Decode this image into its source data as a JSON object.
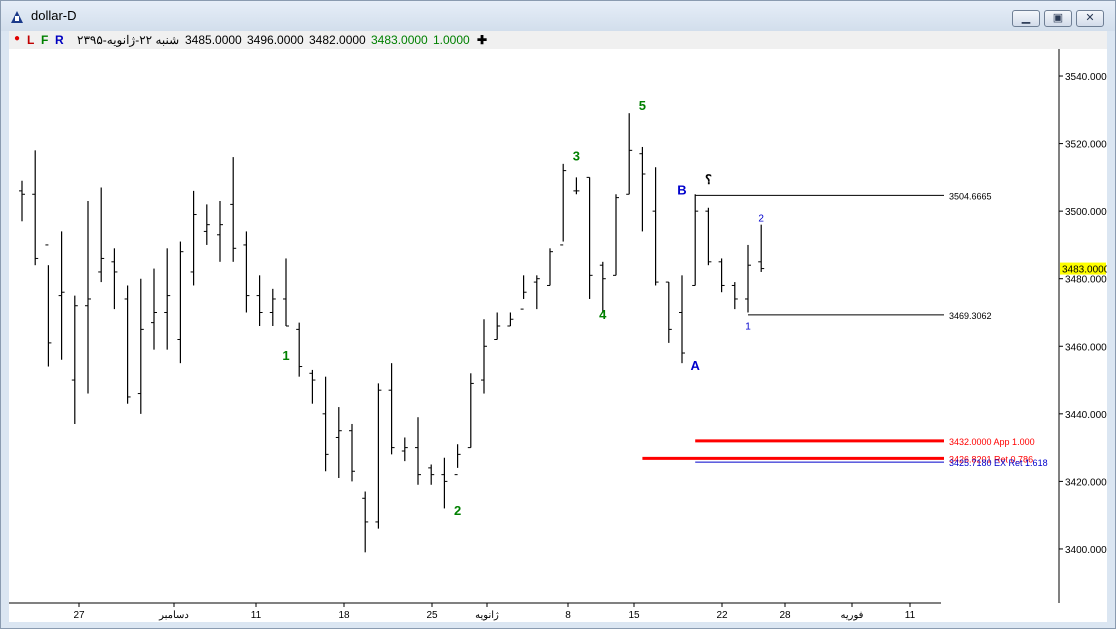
{
  "window": {
    "title": "dollar-D",
    "buttons": [
      "minimize",
      "maximize",
      "close"
    ]
  },
  "toolbar": {
    "dot": "●",
    "l_label": "L",
    "f_label": "F",
    "r_label": "R",
    "date": "شنبه ۲۲-ژانویه-۲۳۹۵",
    "open": "3485.0000",
    "high": "3496.0000",
    "low": "3482.0000",
    "close": "3483.0000",
    "volume": "1.0000",
    "crosshair": "✚"
  },
  "colors": {
    "bars": "#000000",
    "wave_labels": "#008000",
    "correction_labels": "#0000cc",
    "fib_red": "#ff0000",
    "fib_blue": "#0000cc",
    "price_tag": "#ffff00"
  },
  "chart_data": {
    "type": "ohlc",
    "ylim": [
      3384,
      3548
    ],
    "y_ticks": [
      3400,
      3420,
      3440,
      3460,
      3480,
      3500,
      3520,
      3540
    ],
    "y_tick_labels": [
      "3400.0000",
      "3420.0000",
      "3440.0000",
      "3460.0000",
      "3480.0000",
      "3500.0000",
      "3520.0000",
      "3540.0000"
    ],
    "x_tick_labels": [
      "27",
      "دسامبر",
      "11",
      "18",
      "25",
      "ژانویه",
      "8",
      "15",
      "22",
      "28",
      "فوریه",
      "11"
    ],
    "current_price": "3483.0000",
    "bars": [
      {
        "o": 3506,
        "h": 3509,
        "l": 3497,
        "c": 3505
      },
      {
        "o": 3505,
        "h": 3518,
        "l": 3484,
        "c": 3486
      },
      {
        "o": 3490,
        "h": 3484,
        "l": 3454,
        "c": 3461
      },
      {
        "o": 3475,
        "h": 3494,
        "l": 3456,
        "c": 3476
      },
      {
        "o": 3450,
        "h": 3475,
        "l": 3437,
        "c": 3472
      },
      {
        "o": 3472,
        "h": 3503,
        "l": 3446,
        "c": 3474
      },
      {
        "o": 3482,
        "h": 3507,
        "l": 3479,
        "c": 3486
      },
      {
        "o": 3485,
        "h": 3489,
        "l": 3471,
        "c": 3482
      },
      {
        "o": 3474,
        "h": 3478,
        "l": 3443,
        "c": 3445
      },
      {
        "o": 3446,
        "h": 3480,
        "l": 3440,
        "c": 3465
      },
      {
        "o": 3467,
        "h": 3483,
        "l": 3459,
        "c": 3470
      },
      {
        "o": 3470,
        "h": 3489,
        "l": 3459,
        "c": 3475
      },
      {
        "o": 3462,
        "h": 3491,
        "l": 3455,
        "c": 3488
      },
      {
        "o": 3482,
        "h": 3506,
        "l": 3478,
        "c": 3499
      },
      {
        "o": 3494,
        "h": 3502,
        "l": 3490,
        "c": 3496
      },
      {
        "o": 3493,
        "h": 3503,
        "l": 3485,
        "c": 3496
      },
      {
        "o": 3502,
        "h": 3516,
        "l": 3485,
        "c": 3489
      },
      {
        "o": 3490,
        "h": 3494,
        "l": 3470,
        "c": 3475
      },
      {
        "o": 3475,
        "h": 3481,
        "l": 3466,
        "c": 3470
      },
      {
        "o": 3470,
        "h": 3477,
        "l": 3466,
        "c": 3474
      },
      {
        "o": 3474,
        "h": 3486,
        "l": 3466,
        "c": 3466
      },
      {
        "o": 3465,
        "h": 3467,
        "l": 3451,
        "c": 3454
      },
      {
        "o": 3452,
        "h": 3453,
        "l": 3443,
        "c": 3450
      },
      {
        "o": 3440,
        "h": 3451,
        "l": 3423,
        "c": 3428
      },
      {
        "o": 3433,
        "h": 3442,
        "l": 3421,
        "c": 3435
      },
      {
        "o": 3435,
        "h": 3437,
        "l": 3420,
        "c": 3423
      },
      {
        "o": 3415,
        "h": 3417,
        "l": 3399,
        "c": 3408
      },
      {
        "o": 3408,
        "h": 3449,
        "l": 3406,
        "c": 3447
      },
      {
        "o": 3447,
        "h": 3455,
        "l": 3428,
        "c": 3430
      },
      {
        "o": 3429,
        "h": 3433,
        "l": 3426,
        "c": 3430
      },
      {
        "o": 3430,
        "h": 3439,
        "l": 3419,
        "c": 3422
      },
      {
        "o": 3424,
        "h": 3425,
        "l": 3419,
        "c": 3422
      },
      {
        "o": 3422,
        "h": 3427,
        "l": 3412,
        "c": 3420
      },
      {
        "o": 3422,
        "h": 3431,
        "l": 3424,
        "c": 3428
      },
      {
        "o": 3430,
        "h": 3452,
        "l": 3430,
        "c": 3449
      },
      {
        "o": 3450,
        "h": 3468,
        "l": 3446,
        "c": 3460
      },
      {
        "o": 3462,
        "h": 3470,
        "l": 3462,
        "c": 3466
      },
      {
        "o": 3466,
        "h": 3470,
        "l": 3466,
        "c": 3468
      },
      {
        "o": 3471,
        "h": 3481,
        "l": 3474,
        "c": 3476
      },
      {
        "o": 3479,
        "h": 3481,
        "l": 3471,
        "c": 3480
      },
      {
        "o": 3478,
        "h": 3489,
        "l": 3478,
        "c": 3488
      },
      {
        "o": 3490,
        "h": 3514,
        "l": 3491,
        "c": 3512
      },
      {
        "o": 3506,
        "h": 3510,
        "l": 3505,
        "c": 3506
      },
      {
        "o": 3510,
        "h": 3510,
        "l": 3474,
        "c": 3481
      },
      {
        "o": 3484,
        "h": 3485,
        "l": 3470,
        "c": 3480
      },
      {
        "o": 3481,
        "h": 3505,
        "l": 3481,
        "c": 3504
      },
      {
        "o": 3505,
        "h": 3529,
        "l": 3505,
        "c": 3518
      },
      {
        "o": 3517,
        "h": 3519,
        "l": 3494,
        "c": 3511
      },
      {
        "o": 3500,
        "h": 3513,
        "l": 3478,
        "c": 3479
      },
      {
        "o": 3479,
        "h": 3479,
        "l": 3461,
        "c": 3465
      },
      {
        "o": 3470,
        "h": 3481,
        "l": 3455,
        "c": 3458
      },
      {
        "o": 3478,
        "h": 3505,
        "l": 3478,
        "c": 3500
      },
      {
        "o": 3500,
        "h": 3501,
        "l": 3484,
        "c": 3485
      },
      {
        "o": 3485,
        "h": 3486,
        "l": 3476,
        "c": 3478
      },
      {
        "o": 3478,
        "h": 3479,
        "l": 3471,
        "c": 3474
      },
      {
        "o": 3474,
        "h": 3490,
        "l": 3470,
        "c": 3484
      },
      {
        "o": 3485,
        "h": 3496,
        "l": 3482,
        "c": 3483
      }
    ],
    "wave_labels": [
      {
        "text": "1",
        "bar": 20,
        "price": 3456
      },
      {
        "text": "2",
        "bar": 33,
        "price": 3410
      },
      {
        "text": "3",
        "bar": 42,
        "price": 3515
      },
      {
        "text": "4",
        "bar": 44,
        "price": 3468
      },
      {
        "text": "5",
        "bar": 47,
        "price": 3530
      },
      {
        "text": "A",
        "bar": 51,
        "price": 3453
      },
      {
        "text": "B",
        "bar": 50,
        "price": 3505
      },
      {
        "text": "؟",
        "bar": 52,
        "price": 3508
      },
      {
        "text": "1",
        "bar": 55,
        "price": 3465
      },
      {
        "text": "2",
        "bar": 56,
        "price": 3497
      }
    ],
    "levels": [
      {
        "label": "3504.6665",
        "price": 3504.6665,
        "color": "#000000",
        "from_bar": 51
      },
      {
        "label": "3469.3062",
        "price": 3469.3062,
        "color": "#000000",
        "from_bar": 55
      },
      {
        "label": "3432.0000 App 1.000",
        "price": 3432.0,
        "color": "#ff0000",
        "from_bar": 51
      },
      {
        "label": "3426.8201 Ret 0.786",
        "price": 3426.8201,
        "color": "#ff0000",
        "from_bar": 47
      },
      {
        "label": "3425.7180 EX Ret 1.618",
        "price": 3425.718,
        "color": "#0000cc",
        "from_bar": 51
      }
    ]
  }
}
